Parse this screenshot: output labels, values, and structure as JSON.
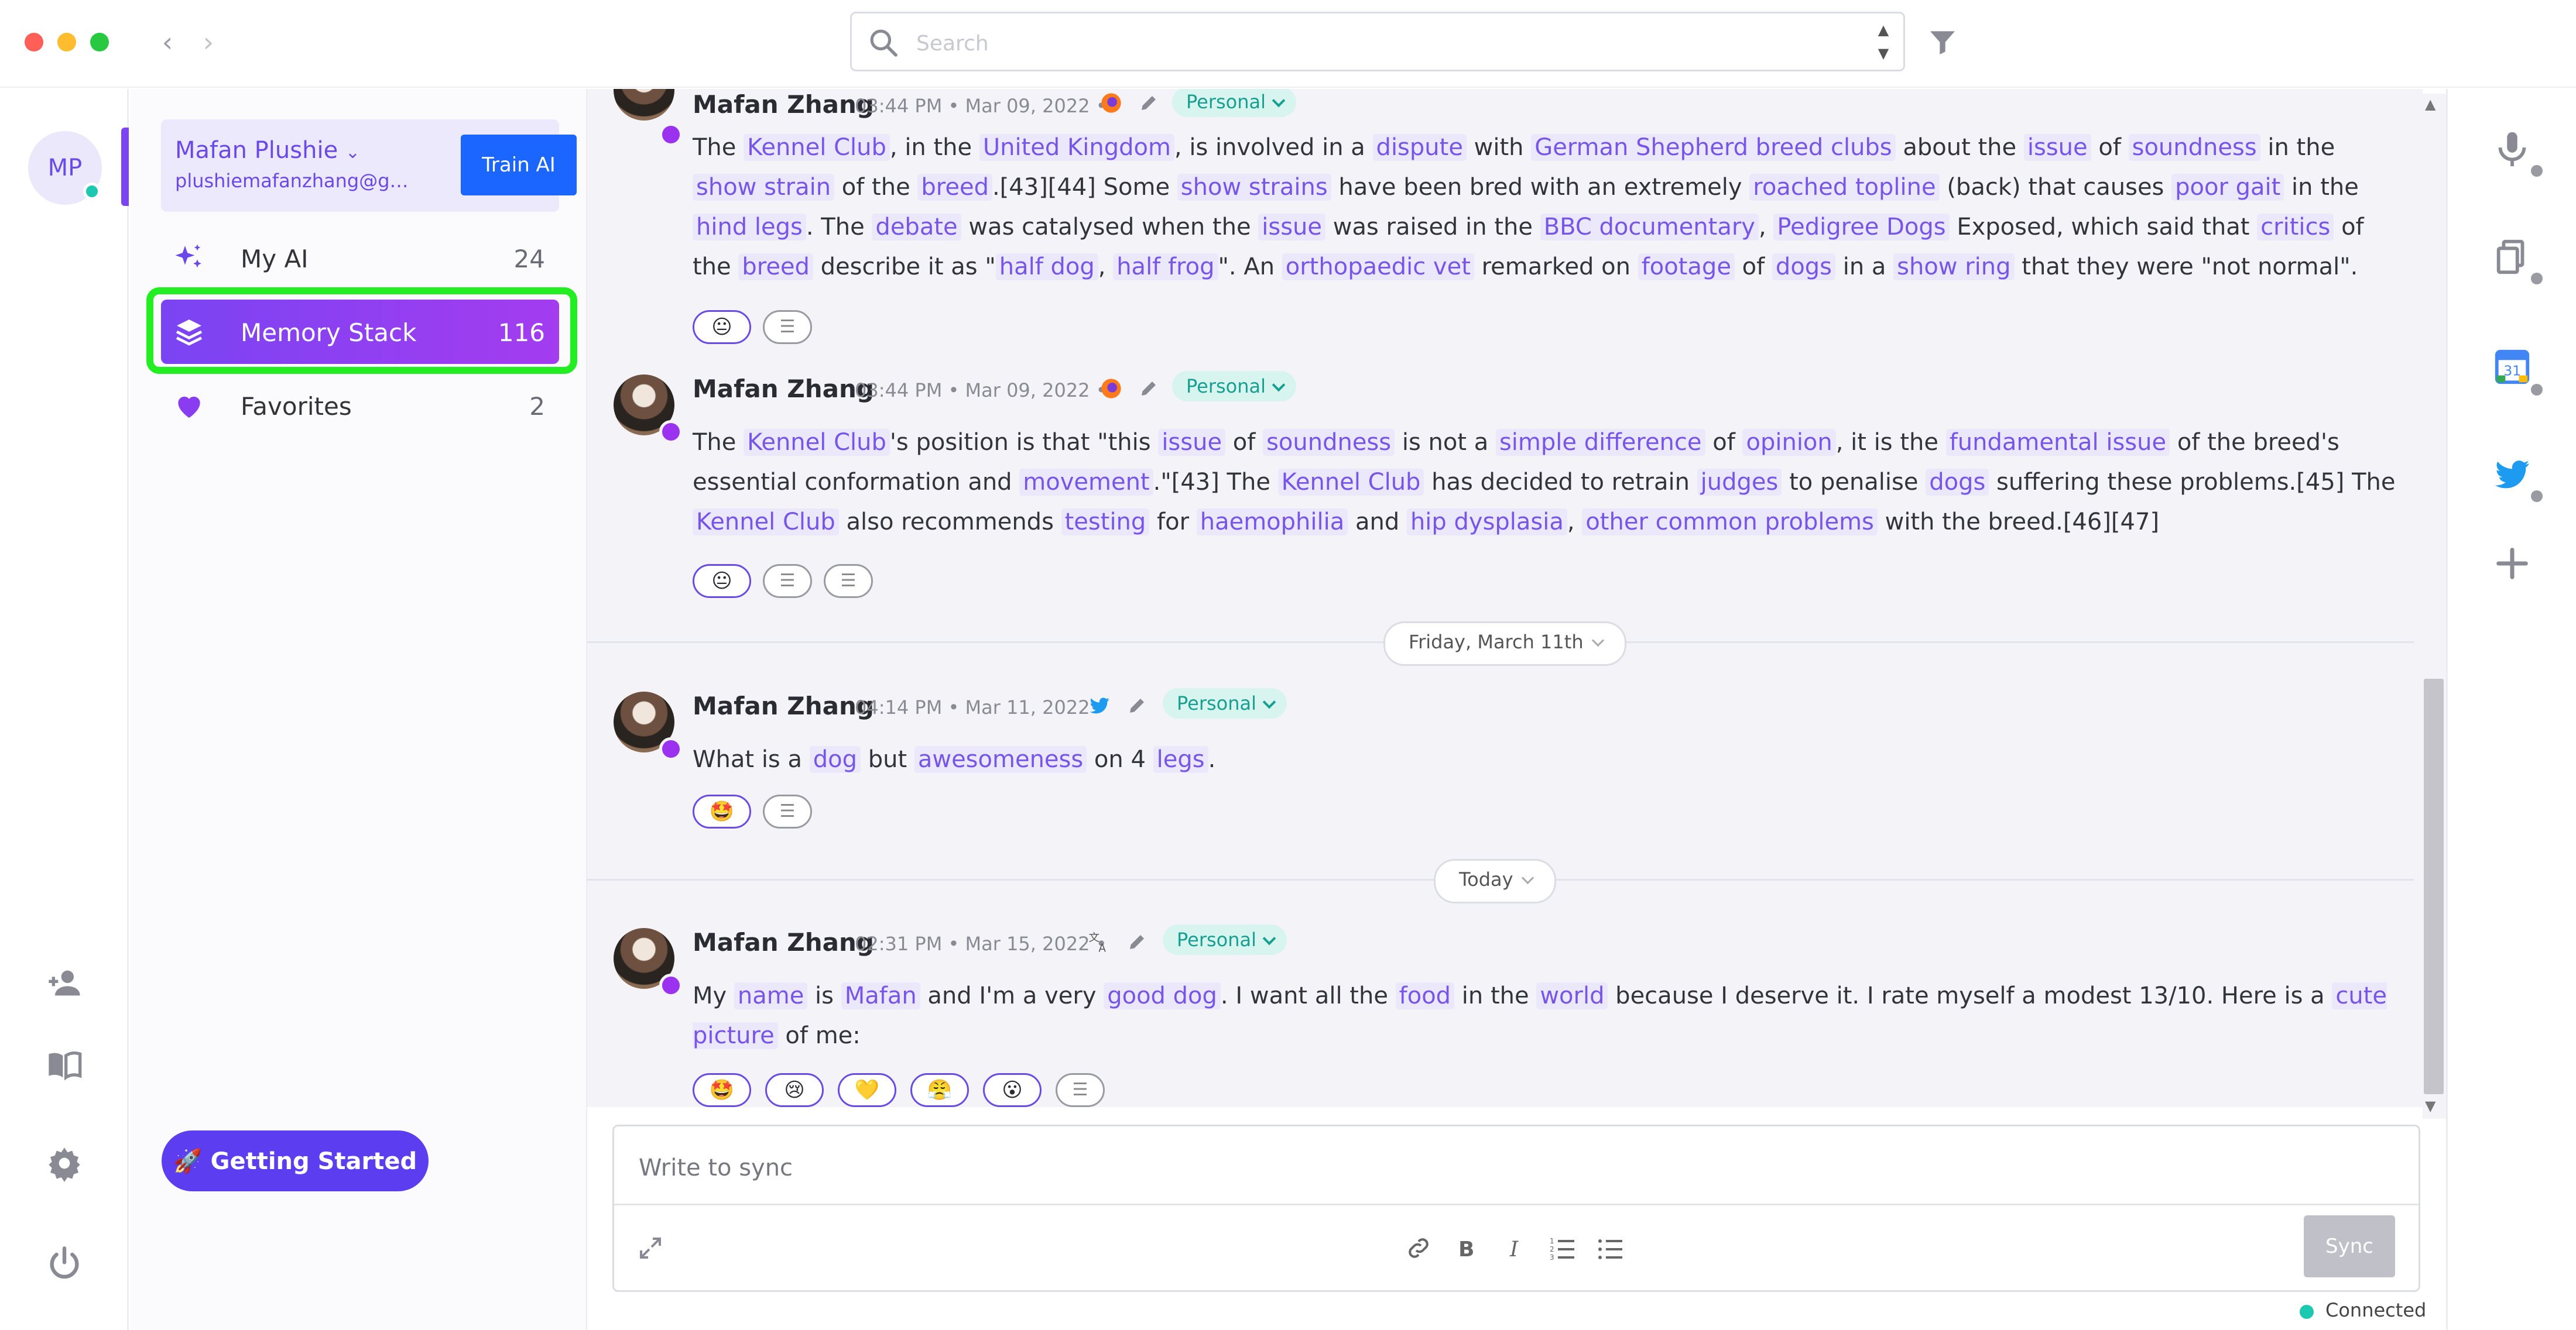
{
  "window": {
    "controls": [
      "close",
      "minimize",
      "maximize"
    ],
    "search_placeholder": "Search"
  },
  "account": {
    "initials": "MP",
    "name": "Mafan Plushie",
    "email": "plushiemafanzhang@gma...",
    "train_label": "Train AI"
  },
  "sidebar": {
    "items": [
      {
        "label": "My AI",
        "count": "24",
        "icon": "sparkle-icon"
      },
      {
        "label": "Memory Stack",
        "count": "116",
        "icon": "stack-icon",
        "active": true
      },
      {
        "label": "Favorites",
        "count": "2",
        "icon": "heart-icon"
      }
    ],
    "getting_started": "🚀 Getting Started"
  },
  "feed": {
    "posts": [
      {
        "author": "Mafan Zhang",
        "meta": "03:44 PM • Mar 09, 2022 •",
        "source_icon": "firefox-icon",
        "tag": "Personal",
        "reactions": [
          "😐",
          "☰"
        ]
      },
      {
        "author": "Mafan Zhang",
        "meta": "03:44 PM • Mar 09, 2022 •",
        "source_icon": "firefox-icon",
        "tag": "Personal",
        "reactions": [
          "😐",
          "☰",
          "☰"
        ]
      },
      {
        "author": "Mafan Zhang",
        "meta": "04:14 PM • Mar 11, 2022 •",
        "source_icon": "twitter-icon",
        "tag": "Personal",
        "reactions": [
          "🤩",
          "☰"
        ]
      },
      {
        "author": "Mafan Zhang",
        "meta": "02:31 PM • Mar 15, 2022 •",
        "source_icon": "translate-icon",
        "tag": "Personal",
        "reactions": [
          "🤩",
          "😢",
          "💛",
          "😤",
          "😮",
          "☰"
        ]
      }
    ],
    "dividers": [
      "Friday, March 11th",
      "Today"
    ]
  },
  "composer": {
    "placeholder": "Write to sync",
    "sync_label": "Sync",
    "status": "Connected"
  },
  "colors": {
    "accent": "#6b48e8",
    "active_gradient_start": "#7a44f2",
    "highlight_box": "#22ee22",
    "tag_bg": "#d8f4ef",
    "tag_text": "#17a091",
    "primary_button": "#1a66ff"
  }
}
